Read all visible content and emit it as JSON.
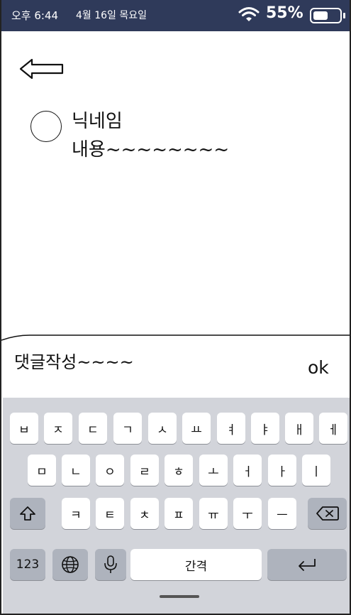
{
  "status_bar": {
    "time": "오후 6:44",
    "date": "4월 16일 목요일",
    "battery_percent": "55%",
    "battery_level": 0.55,
    "wifi_icon": "wifi-icon"
  },
  "post": {
    "nickname": "닉네임",
    "content": "내용~~~~~~~~"
  },
  "comment": {
    "input_text": "댓글작성~~~~",
    "submit_label": "ok"
  },
  "keyboard": {
    "row1": [
      "ㅂ",
      "ㅈ",
      "ㄷ",
      "ㄱ",
      "ㅅ",
      "ㅛ",
      "ㅕ",
      "ㅑ",
      "ㅐ",
      "ㅔ"
    ],
    "row2": [
      "ㅁ",
      "ㄴ",
      "ㅇ",
      "ㄹ",
      "ㅎ",
      "ㅗ",
      "ㅓ",
      "ㅏ",
      "ㅣ"
    ],
    "row3": [
      "ㅋ",
      "ㅌ",
      "ㅊ",
      "ㅍ",
      "ㅠ",
      "ㅜ",
      "ㅡ"
    ],
    "numbers_label": "123",
    "space_label": "간격"
  },
  "colors": {
    "status_bar_bg": "#2f3a5a",
    "keyboard_bg": "#d2d4da",
    "dark_key": "#aeb3bd"
  }
}
